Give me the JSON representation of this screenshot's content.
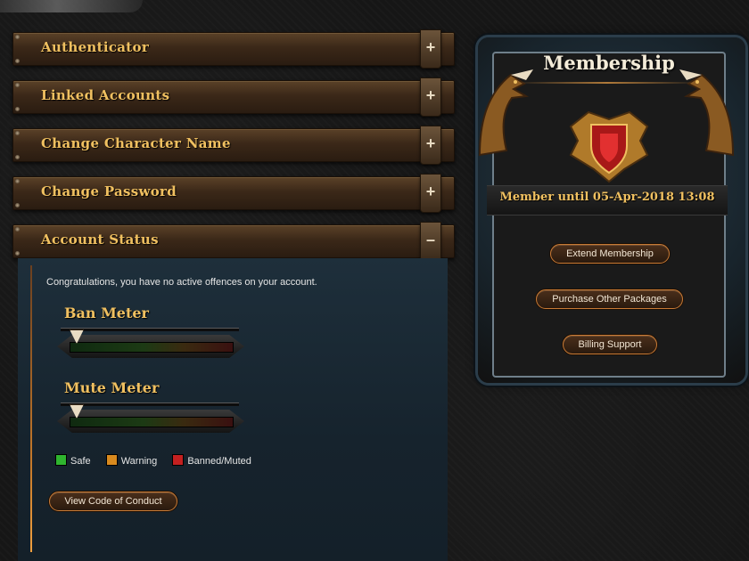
{
  "accordion": {
    "sections": [
      {
        "label": "Authenticator",
        "toggle": "+"
      },
      {
        "label": "Linked Accounts",
        "toggle": "+"
      },
      {
        "label": "Change Character Name",
        "toggle": "+"
      },
      {
        "label": "Change Password",
        "toggle": "+"
      },
      {
        "label": "Account Status",
        "toggle": "–"
      }
    ]
  },
  "account_status": {
    "message": "Congratulations, you have no active offences on your account.",
    "ban_meter": {
      "title": "Ban Meter",
      "level": 0
    },
    "mute_meter": {
      "title": "Mute Meter",
      "level": 0
    },
    "legend": {
      "safe": "Safe",
      "warning": "Warning",
      "banned": "Banned/Muted"
    },
    "code_of_conduct_button": "View Code of Conduct"
  },
  "membership": {
    "title": "Membership",
    "status": "Member until 05-Apr-2018 13:08",
    "buttons": {
      "extend": "Extend Membership",
      "packages": "Purchase Other Packages",
      "billing": "Billing Support"
    }
  },
  "colors": {
    "safe": "#2fb52f",
    "warning": "#d98a1e",
    "banned": "#c42020",
    "gold_text": "#f0c060"
  }
}
